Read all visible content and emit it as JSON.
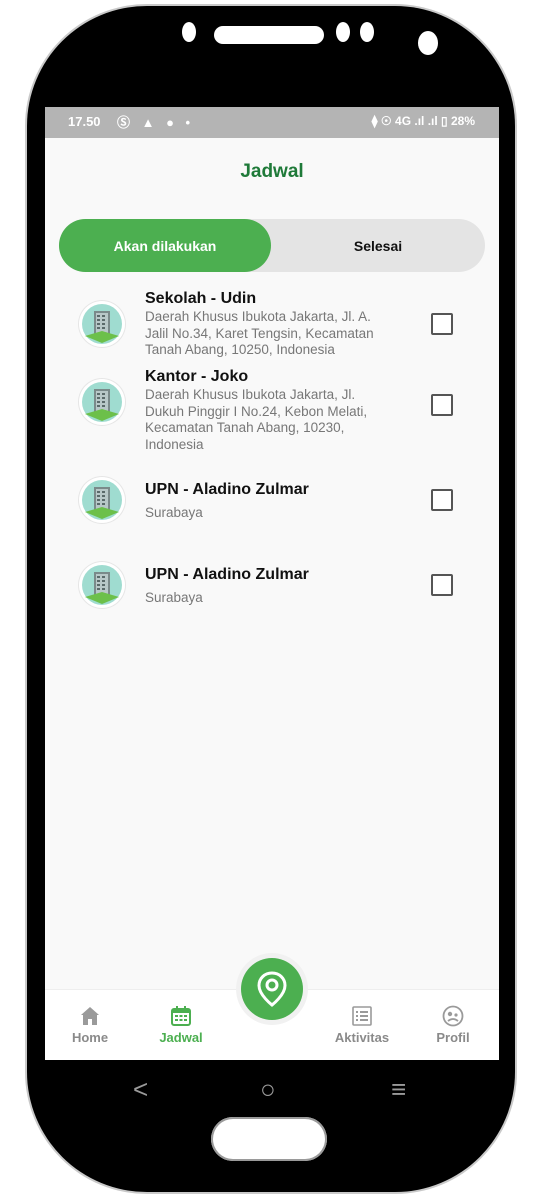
{
  "status_bar": {
    "time": "17.50",
    "left_icons": "Ⓢ ▲ ● •",
    "right_text": "⧫ ☉ 4G .ıl .ıl ▯ 28%"
  },
  "header": {
    "title": "Jadwal"
  },
  "tabs": [
    {
      "label": "Akan dilakukan",
      "active": true
    },
    {
      "label": "Selesai",
      "active": false
    }
  ],
  "schedule": [
    {
      "title": "Sekolah - Udin",
      "address": "Daerah Khusus Ibukota Jakarta, Jl. A. Jalil No.34, Karet Tengsin, Kecamatan Tanah Abang, 10250, Indonesia",
      "checked": false
    },
    {
      "title": "Kantor - Joko",
      "address": "Daerah Khusus Ibukota Jakarta, Jl. Dukuh Pinggir I No.24, Kebon Melati, Kecamatan Tanah Abang, 10230, Indonesia",
      "checked": false
    },
    {
      "title": "UPN - Aladino Zulmar",
      "address": "Surabaya",
      "checked": false
    },
    {
      "title": "UPN - Aladino Zulmar",
      "address": "Surabaya",
      "checked": false
    }
  ],
  "bottom_nav": [
    {
      "label": "Home",
      "icon": "home-icon"
    },
    {
      "label": "Jadwal",
      "icon": "calendar-icon",
      "active": true
    },
    {
      "label": "Aktivitas",
      "icon": "list-icon"
    },
    {
      "label": "Profil",
      "icon": "profile-icon"
    }
  ],
  "fab": {
    "icon": "location-pin-icon"
  },
  "system_nav": {
    "back": "<",
    "home": "○",
    "recents": "≡"
  },
  "colors": {
    "accent": "#4caf50",
    "title": "#1f7a39"
  }
}
